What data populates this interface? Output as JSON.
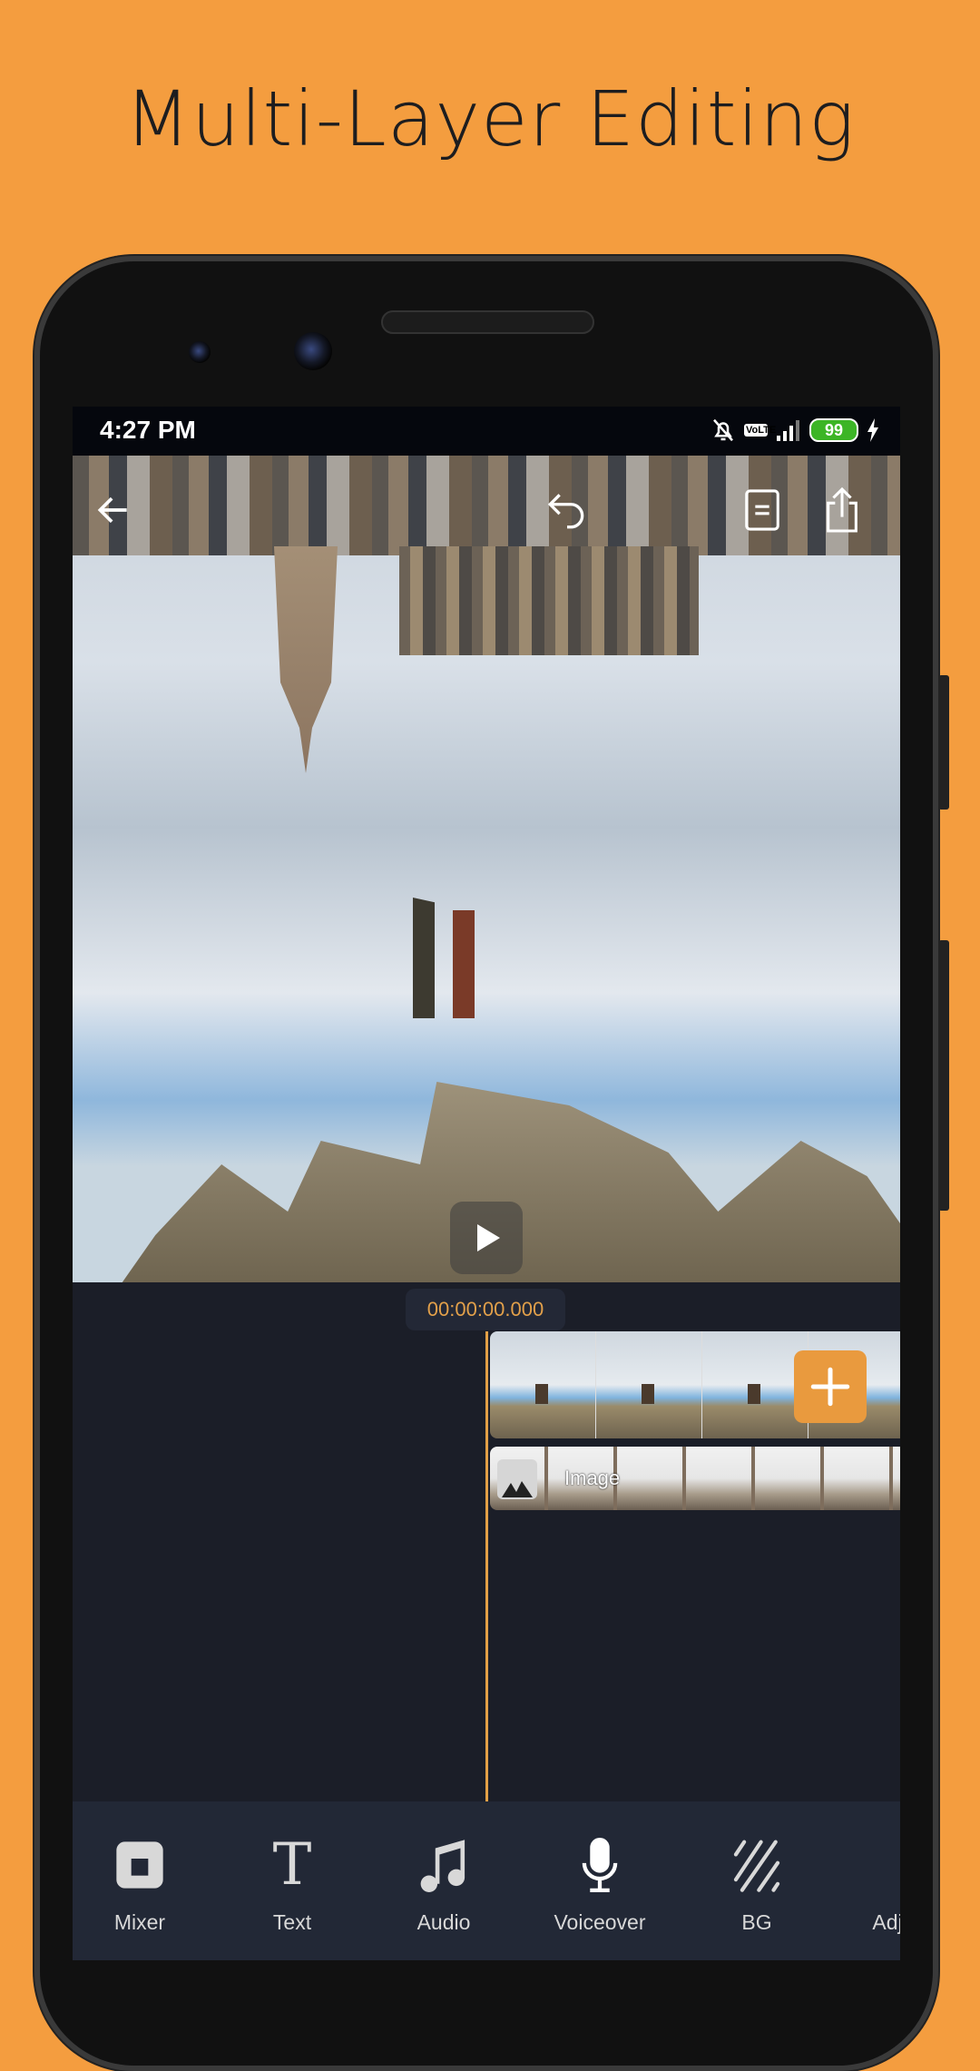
{
  "headline": "Multi-Layer Editing",
  "status_bar": {
    "time": "4:27 PM",
    "network": "VoLTE",
    "battery": "99",
    "icons": [
      "bell-muted-icon",
      "volte-icon",
      "signal-icon",
      "battery-icon",
      "charging-icon"
    ]
  },
  "editor": {
    "top_bar": [
      "back-icon",
      "undo-icon",
      "layers-icon",
      "export-icon"
    ],
    "timecode": "00:00:00.000",
    "tracks": [
      {
        "type": "video",
        "frames": 4
      },
      {
        "type": "image",
        "label": "Image"
      }
    ],
    "accent": "#e99a3e"
  },
  "toolbar": {
    "items": [
      {
        "label": "Mixer",
        "icon": "mixer-icon"
      },
      {
        "label": "Text",
        "icon": "text-icon"
      },
      {
        "label": "Audio",
        "icon": "music-note-icon"
      },
      {
        "label": "Voiceover",
        "icon": "microphone-icon"
      },
      {
        "label": "BG",
        "icon": "background-icon"
      },
      {
        "label": "Adj",
        "icon": "adjust-icon"
      }
    ]
  }
}
